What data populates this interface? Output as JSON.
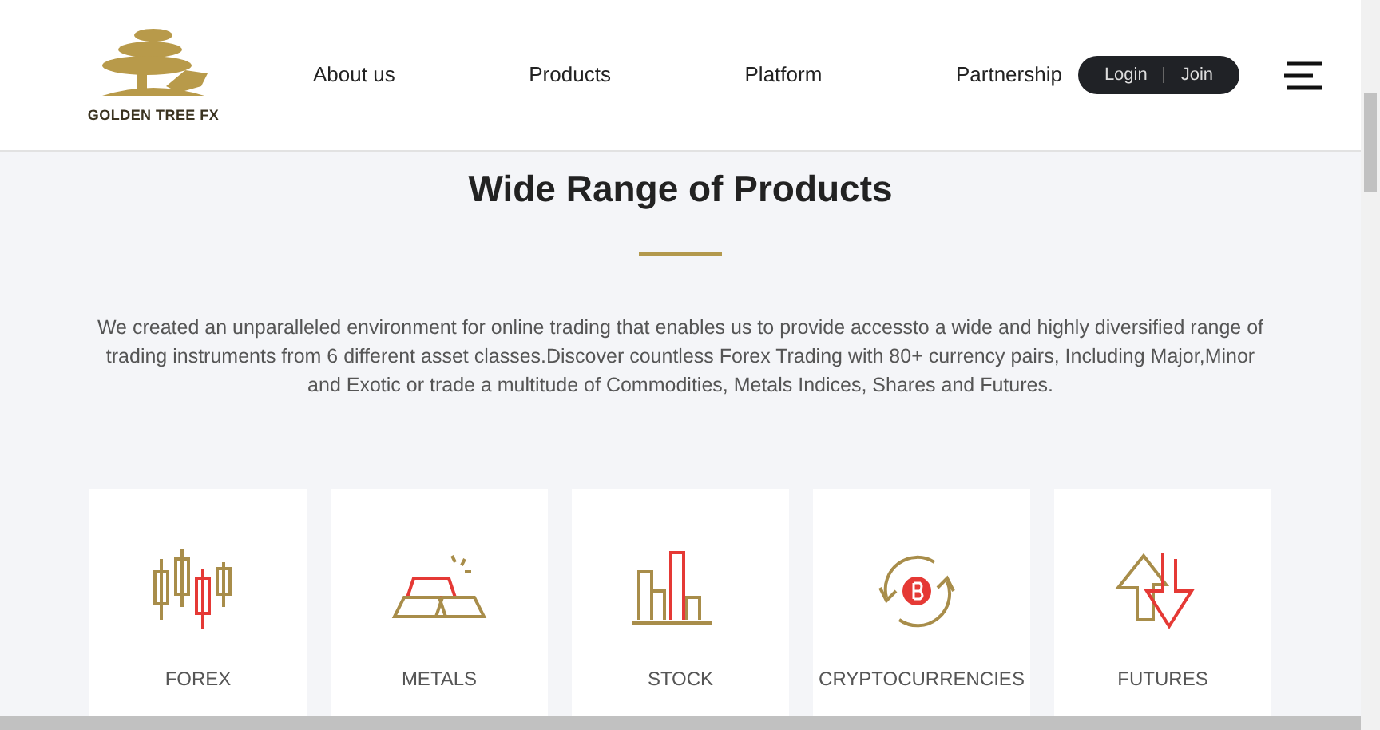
{
  "header": {
    "logo_text": "GOLDEN TREE FX",
    "nav": [
      "About us",
      "Products",
      "Platform",
      "Partnership"
    ],
    "auth": [
      "Login",
      "Join"
    ]
  },
  "section": {
    "title": "Wide Range of Products",
    "description": "We created an unparalleled environment for online trading that enables us to provide accessto a wide and highly diversified range of trading instruments from 6 different asset classes.Discover countless Forex Trading with 80+ currency pairs, Including Major,Minor and Exotic or trade a multitude of Commodities, Metals Indices, Shares and Futures."
  },
  "products": [
    {
      "label": "FOREX",
      "kind": "candles"
    },
    {
      "label": "METALS",
      "kind": "bars"
    },
    {
      "label": "STOCK",
      "kind": "chart"
    },
    {
      "label": "CRYPTOCURRENCIES",
      "kind": "coin"
    },
    {
      "label": "FUTURES",
      "kind": "arrows"
    }
  ]
}
